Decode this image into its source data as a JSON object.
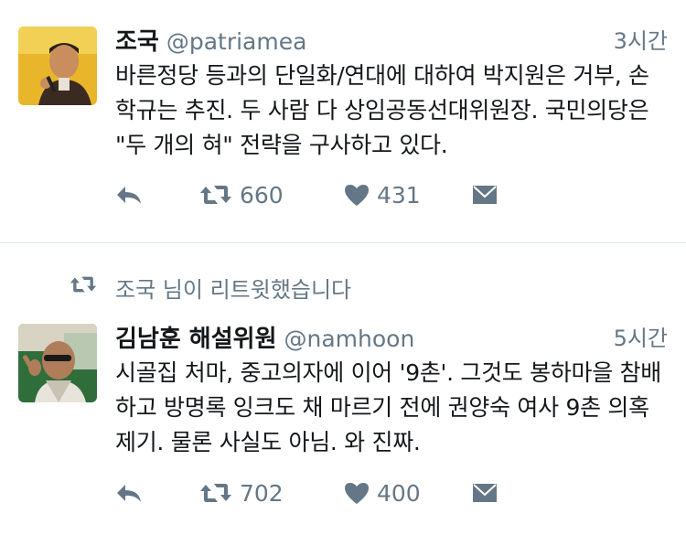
{
  "tweets": [
    {
      "author_name": "조국",
      "handle": "@patriamea",
      "time": "3시간",
      "text": "바른정당 등과의 단일화/연대에 대하여 박지원은 거부, 손학규는 추진. 두 사람 다 상임공동선대위원장. 국민의당은 \"두 개의 혀\" 전략을 구사하고 있다.",
      "retweets": "660",
      "likes": "431"
    },
    {
      "retweet_context": "조국 님이 리트윗했습니다",
      "author_name": "김남훈 해설위원",
      "handle": "@namhoon",
      "time": "5시간",
      "text": "시골집 처마, 중고의자에 이어 '9촌'. 그것도 봉하마을 참배하고 방명록 잉크도 채 마르기 전에 권양숙 여사 9촌 의혹 제기. 물론 사실도 아님. 와 진짜.",
      "retweets": "702",
      "likes": "400"
    }
  ],
  "colors": {
    "text": "#14171a",
    "secondary": "#657786",
    "divider": "#e1e8ed",
    "avatar1_bg": "#e9b52a",
    "avatar2_bg": "#2f6e3b"
  },
  "icons": {
    "reply": "reply-icon",
    "retweet": "retweet-icon",
    "like": "heart-icon",
    "dm": "envelope-icon"
  }
}
